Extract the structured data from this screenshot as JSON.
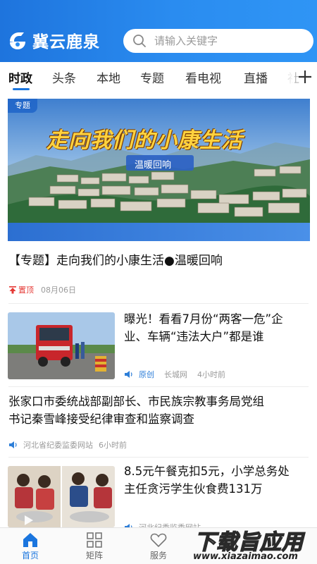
{
  "header": {
    "app_name": "冀云鹿泉",
    "search_placeholder": "请输入关键字",
    "colors": {
      "primary": "#1e74dd",
      "accent": "#2f95f5"
    }
  },
  "tabs": [
    {
      "label": "时政",
      "active": true
    },
    {
      "label": "头条"
    },
    {
      "label": "本地"
    },
    {
      "label": "专题"
    },
    {
      "label": "看电视"
    },
    {
      "label": "直播"
    },
    {
      "label": "社"
    }
  ],
  "feature": {
    "badge": "专题",
    "banner_headline": "走向我们的小康生活",
    "banner_sub": "温暖回响",
    "title": "【专题】走向我们的小康生活●温暖回响",
    "pin_label": "置顶",
    "date": "08月06日"
  },
  "news": [
    {
      "title_line1": "曝光！看看7月份“两客一危”企",
      "title_line2": "业、车辆“违法大户”都是谁",
      "tag": "原创",
      "source": "长城网",
      "time": "4小时前"
    },
    {
      "title_line1": "张家口市委统战部副部长、市民族宗教事务局党组",
      "title_line2": "书记秦雪峰接受纪律审查和监察调查",
      "source": "河北省纪委监委网站",
      "time": "6小时前"
    },
    {
      "title_line1": "8.5元午餐克扣5元，小学总务处",
      "title_line2": "主任贪污学生伙食费131万",
      "source": "河北纪委监委网站"
    }
  ],
  "bottom_nav": [
    {
      "label": "首页",
      "icon": "home-icon",
      "active": true
    },
    {
      "label": "矩阵",
      "icon": "grid-icon"
    },
    {
      "label": "服务",
      "icon": "heart-icon"
    }
  ],
  "watermark": {
    "text": "下载旨应用",
    "url": "www.xiazaimao.com"
  }
}
